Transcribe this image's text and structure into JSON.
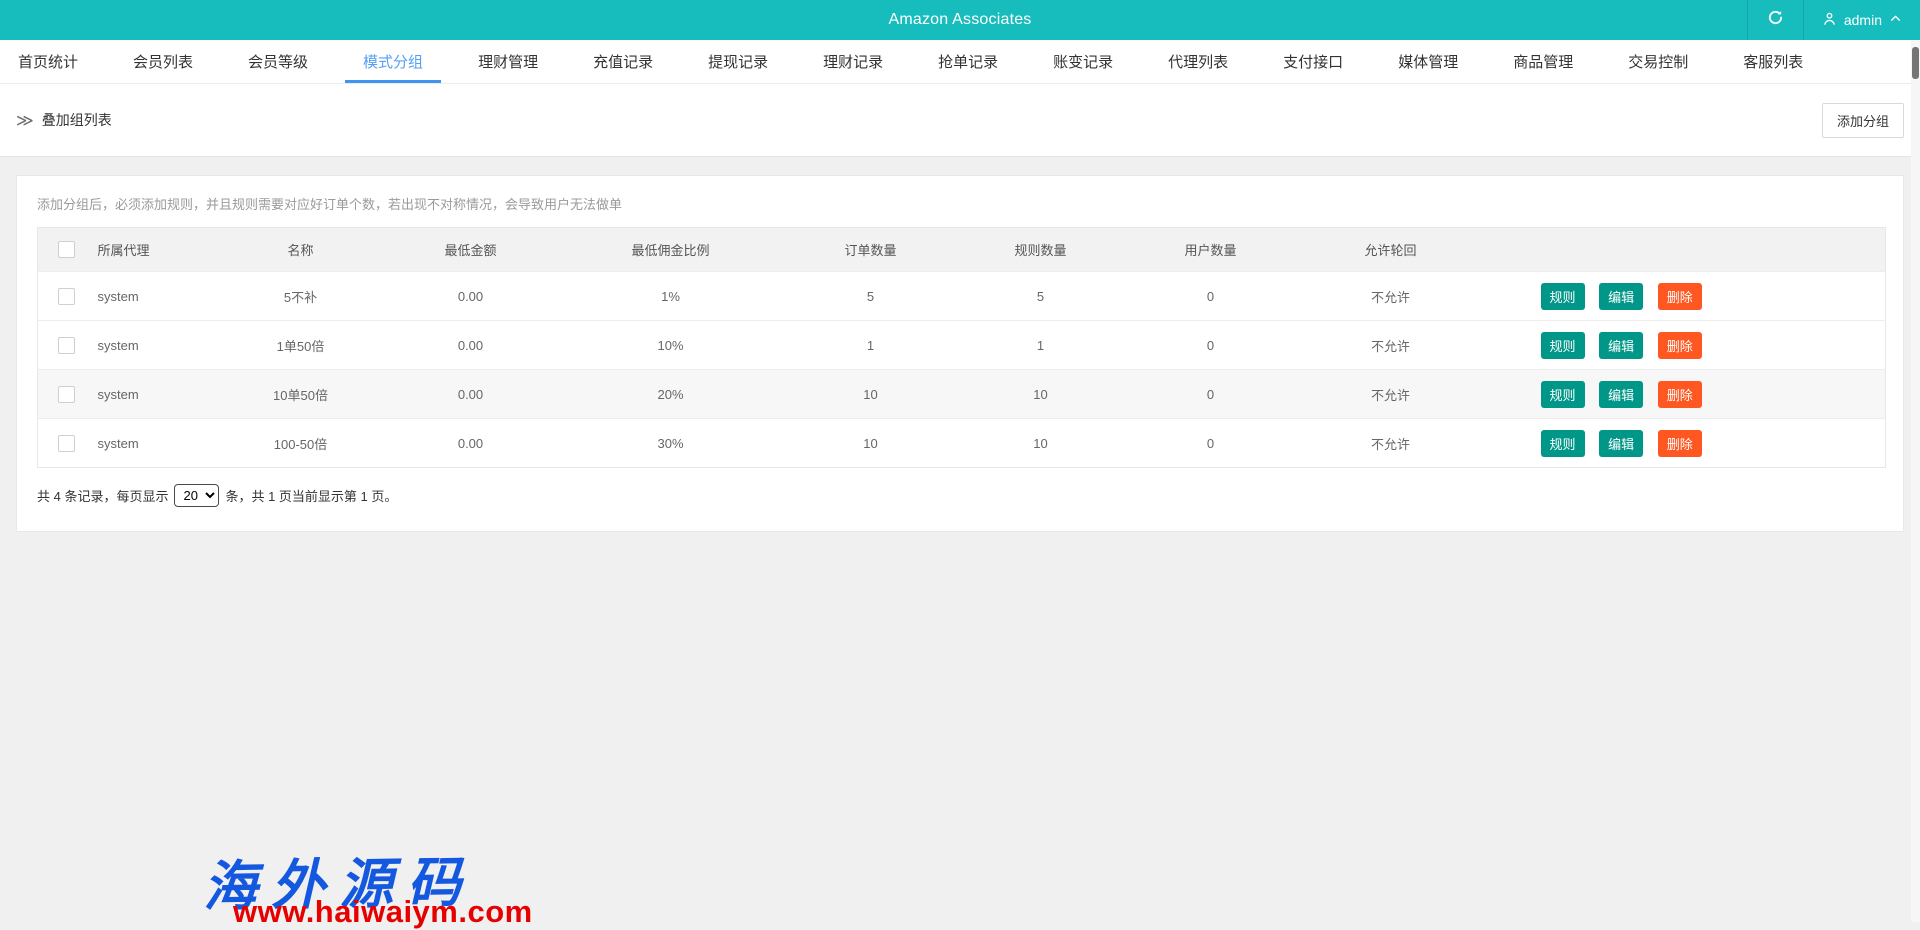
{
  "header": {
    "title": "Amazon Associates",
    "username": "admin"
  },
  "nav": {
    "tabs": [
      {
        "label": "首页统计",
        "active": false
      },
      {
        "label": "会员列表",
        "active": false
      },
      {
        "label": "会员等级",
        "active": false
      },
      {
        "label": "模式分组",
        "active": true
      },
      {
        "label": "理财管理",
        "active": false
      },
      {
        "label": "充值记录",
        "active": false
      },
      {
        "label": "提现记录",
        "active": false
      },
      {
        "label": "理财记录",
        "active": false
      },
      {
        "label": "抢单记录",
        "active": false
      },
      {
        "label": "账变记录",
        "active": false
      },
      {
        "label": "代理列表",
        "active": false
      },
      {
        "label": "支付接口",
        "active": false
      },
      {
        "label": "媒体管理",
        "active": false
      },
      {
        "label": "商品管理",
        "active": false
      },
      {
        "label": "交易控制",
        "active": false
      },
      {
        "label": "客服列表",
        "active": false
      }
    ]
  },
  "breadcrumb": {
    "icon": "double-chevron-right",
    "label": "叠加组列表",
    "add_button": "添加分组"
  },
  "panel": {
    "notice": "添加分组后，必须添加规则，并且规则需要对应好订单个数，若出现不对称情况，会导致用户无法做单",
    "table": {
      "columns": [
        "所属代理",
        "名称",
        "最低金额",
        "最低佣金比例",
        "订单数量",
        "规则数量",
        "用户数量",
        "允许轮回"
      ],
      "rows": [
        {
          "agent": "system",
          "name": "5不补",
          "min_amount": "0.00",
          "commission": "1%",
          "orders": "5",
          "rules": "5",
          "users": "0",
          "cycle": "不允许",
          "striped": false
        },
        {
          "agent": "system",
          "name": "1单50倍",
          "min_amount": "0.00",
          "commission": "10%",
          "orders": "1",
          "rules": "1",
          "users": "0",
          "cycle": "不允许",
          "striped": false
        },
        {
          "agent": "system",
          "name": "10单50倍",
          "min_amount": "0.00",
          "commission": "20%",
          "orders": "10",
          "rules": "10",
          "users": "0",
          "cycle": "不允许",
          "striped": true
        },
        {
          "agent": "system",
          "name": "100-50倍",
          "min_amount": "0.00",
          "commission": "30%",
          "orders": "10",
          "rules": "10",
          "users": "0",
          "cycle": "不允许",
          "striped": false
        }
      ],
      "actions": {
        "rule": "规则",
        "edit": "编辑",
        "delete": "删除"
      }
    },
    "pagination": {
      "prefix": "共 4 条记录，每页显示",
      "page_size": "20",
      "suffix": "条，共 1 页当前显示第 1 页。"
    }
  },
  "watermark": {
    "line1": "海外源码",
    "line2": "www.haiwaiym.com"
  },
  "colors": {
    "topbar": "#17bcbc",
    "active_tab": "#549ff7",
    "active_underline": "#3c95f1",
    "button_green": "#009688",
    "button_orange": "#ff5722",
    "watermark_blue": "#1558e0",
    "watermark_red": "#e60000"
  }
}
